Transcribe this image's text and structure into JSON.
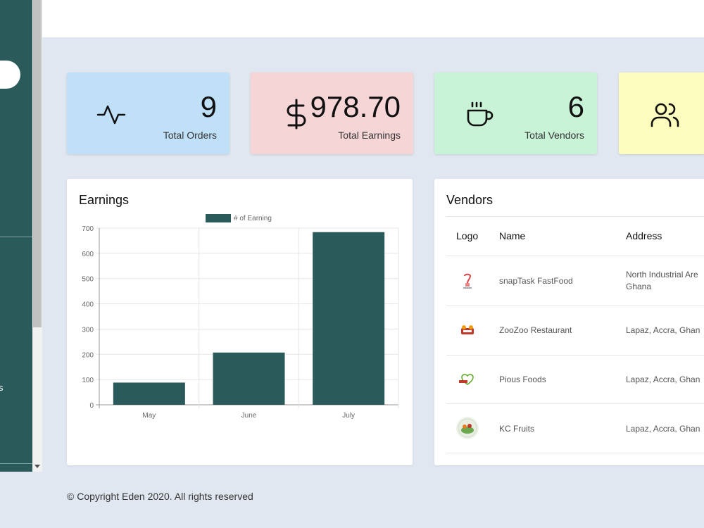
{
  "sidebar": {
    "fragment_text": "s"
  },
  "stats": [
    {
      "value": "9",
      "label": "Total Orders",
      "icon": "activity-icon",
      "bg": "#bfe0f7"
    },
    {
      "value": "978.70",
      "label": "Total Earnings",
      "icon": "dollar-icon",
      "bg": "#f6d5d6"
    },
    {
      "value": "6",
      "label": "Total Vendors",
      "icon": "coffee-icon",
      "bg": "#c8f3d6"
    },
    {
      "value": "",
      "label": "",
      "icon": "users-icon",
      "bg": "#fdfdbf"
    }
  ],
  "earnings": {
    "title": "Earnings"
  },
  "chart_data": {
    "type": "bar",
    "categories": [
      "May",
      "June",
      "July"
    ],
    "series": [
      {
        "name": "# of Earning",
        "values": [
          88,
          207,
          684
        ],
        "color": "#2a5a5a"
      }
    ],
    "ylim": [
      0,
      700
    ],
    "yticks": [
      0,
      100,
      200,
      300,
      400,
      500,
      600,
      700
    ],
    "grid": true,
    "legend": "top-center"
  },
  "vendors": {
    "title": "Vendors",
    "columns": [
      "Logo",
      "Name",
      "Address"
    ],
    "rows": [
      {
        "name": "snapTask FastFood",
        "address_lines": [
          "North Industrial Are",
          "Ghana"
        ],
        "logo": "snaptask-logo"
      },
      {
        "name": "ZooZoo Restaurant",
        "address_lines": [
          "Lapaz, Accra, Ghan"
        ],
        "logo": "zoozoo-logo"
      },
      {
        "name": "Pious Foods",
        "address_lines": [
          "Lapaz, Accra, Ghan"
        ],
        "logo": "pious-logo"
      },
      {
        "name": "KC Fruits",
        "address_lines": [
          "Lapaz, Accra, Ghan"
        ],
        "logo": "kc-fruits-logo"
      }
    ]
  },
  "footer": {
    "text": "© Copyright Eden 2020. All rights reserved"
  }
}
